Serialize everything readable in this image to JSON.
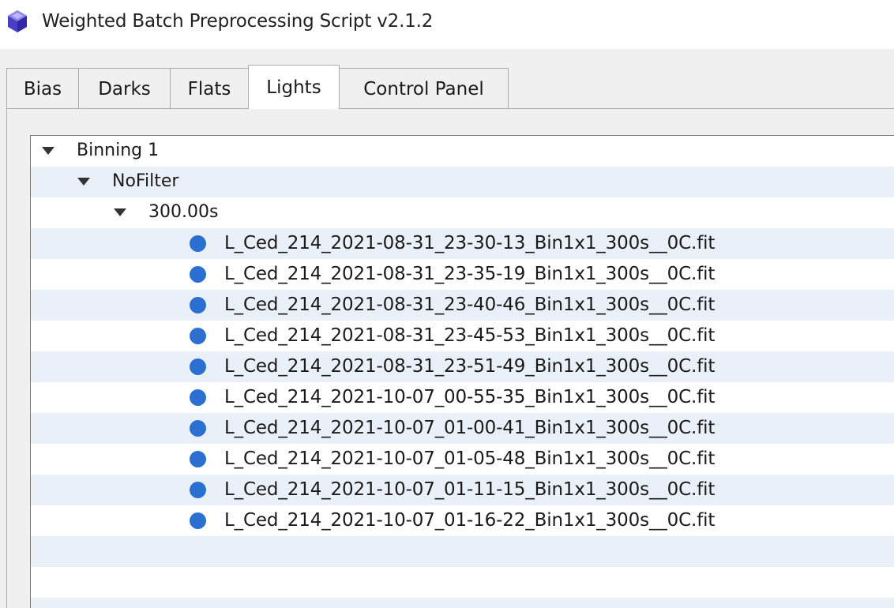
{
  "window": {
    "title": "Weighted Batch Preprocessing Script v2.1.2",
    "icon": "purple-gem-icon"
  },
  "tabs": [
    {
      "label": "Bias",
      "active": false
    },
    {
      "label": "Darks",
      "active": false
    },
    {
      "label": "Flats",
      "active": false
    },
    {
      "label": "Lights",
      "active": true
    },
    {
      "label": "Control Panel",
      "active": false
    }
  ],
  "tree": {
    "binning": {
      "label": "Binning 1",
      "expanded": true
    },
    "filter": {
      "label": "NoFilter",
      "expanded": true
    },
    "exposure": {
      "label": "300.00s",
      "expanded": true
    },
    "files": [
      "L_Ced_214_2021-08-31_23-30-13_Bin1x1_300s__0C.fit",
      "L_Ced_214_2021-08-31_23-35-19_Bin1x1_300s__0C.fit",
      "L_Ced_214_2021-08-31_23-40-46_Bin1x1_300s__0C.fit",
      "L_Ced_214_2021-08-31_23-45-53_Bin1x1_300s__0C.fit",
      "L_Ced_214_2021-08-31_23-51-49_Bin1x1_300s__0C.fit",
      "L_Ced_214_2021-10-07_00-55-35_Bin1x1_300s__0C.fit",
      "L_Ced_214_2021-10-07_01-00-41_Bin1x1_300s__0C.fit",
      "L_Ced_214_2021-10-07_01-05-48_Bin1x1_300s__0C.fit",
      "L_Ced_214_2021-10-07_01-11-15_Bin1x1_300s__0C.fit",
      "L_Ced_214_2021-10-07_01-16-22_Bin1x1_300s__0C.fit"
    ]
  },
  "colors": {
    "file_dot": "#2b6fd0",
    "alt_row": "#e9f0f8",
    "icon_purple": "#5a4fcf"
  }
}
